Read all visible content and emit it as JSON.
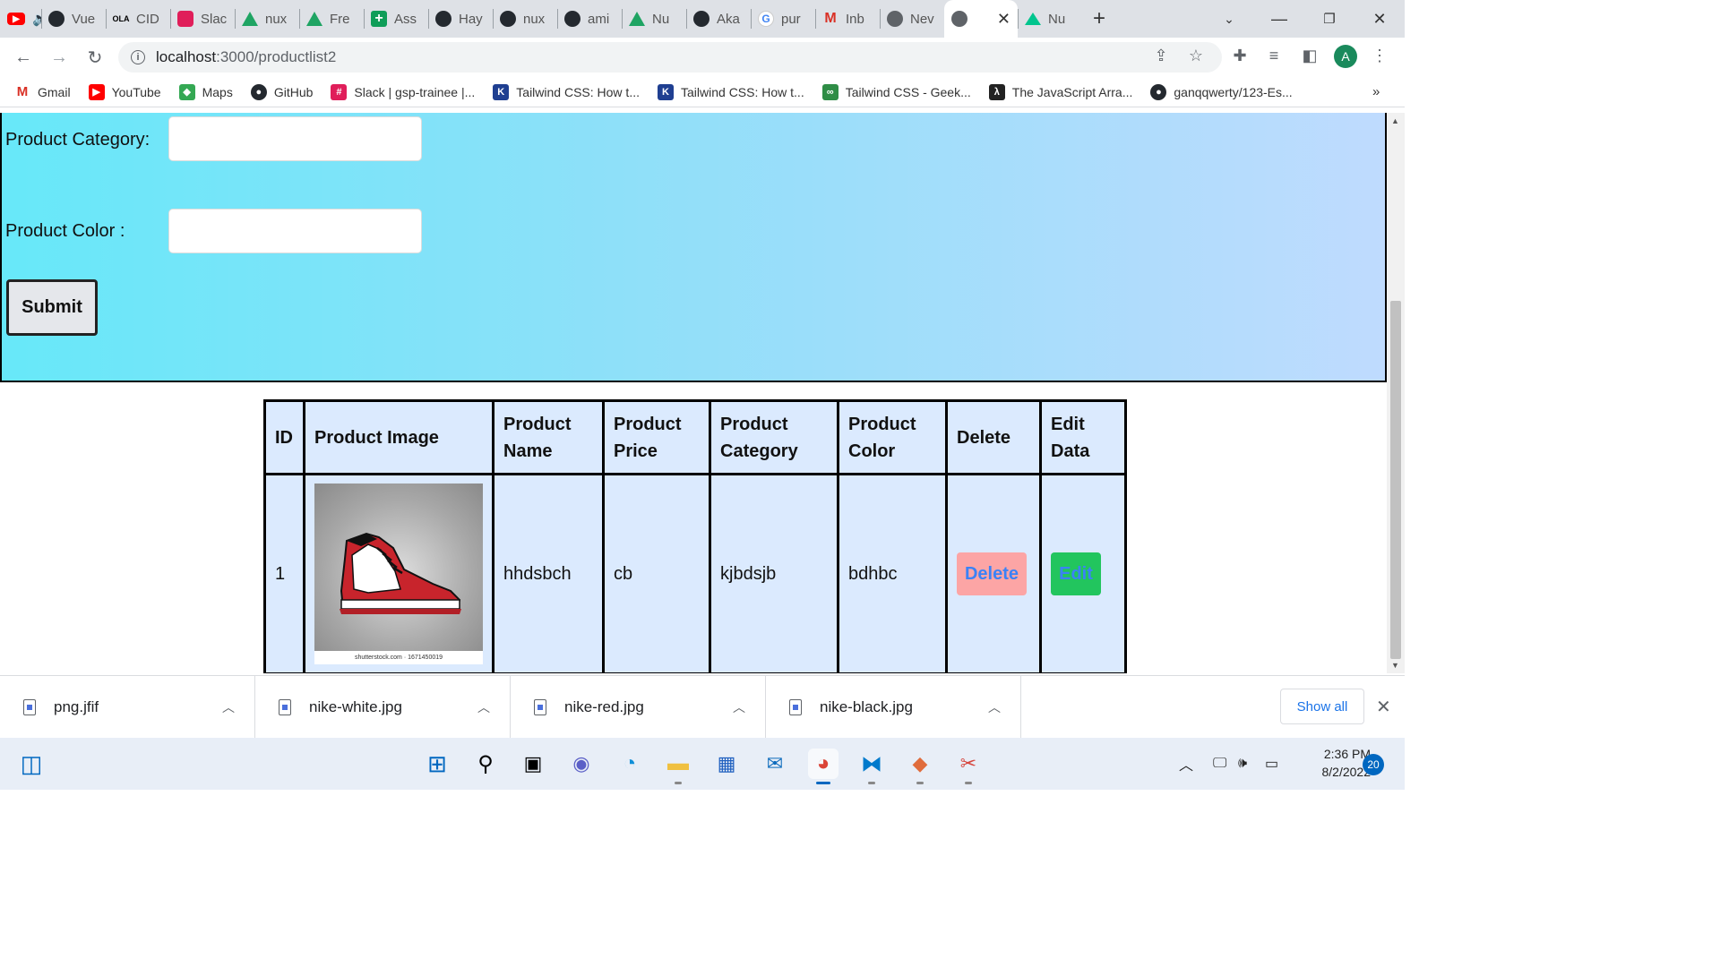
{
  "browser": {
    "tabs": [
      {
        "label": "",
        "icon": "youtube-icon"
      },
      {
        "label": "Vue",
        "icon": "github-icon"
      },
      {
        "label": "CID",
        "icon": "ola-icon"
      },
      {
        "label": "Slac",
        "icon": "slack-icon"
      },
      {
        "label": "nux",
        "icon": "drive-icon"
      },
      {
        "label": "Fre",
        "icon": "drive-icon"
      },
      {
        "label": "Ass",
        "icon": "plus-icon"
      },
      {
        "label": "Hay",
        "icon": "github-icon"
      },
      {
        "label": "nux",
        "icon": "github-icon"
      },
      {
        "label": "ami",
        "icon": "github-icon"
      },
      {
        "label": "Nu",
        "icon": "drive-icon"
      },
      {
        "label": "Aka",
        "icon": "github-icon"
      },
      {
        "label": "pur",
        "icon": "google-icon"
      },
      {
        "label": "Inb",
        "icon": "gmail-icon"
      },
      {
        "label": "Nev",
        "icon": "chrome-icon"
      },
      {
        "label": "",
        "icon": "globe-icon",
        "active": true
      },
      {
        "label": "Nu",
        "icon": "nuxt-icon"
      }
    ],
    "address": {
      "host": "localhost",
      "path": ":3000/productlist2"
    },
    "bookmarks": [
      {
        "label": "Gmail",
        "icon": "gmail-icon",
        "color": "#d93025"
      },
      {
        "label": "YouTube",
        "icon": "youtube-icon",
        "color": "#ff0000"
      },
      {
        "label": "Maps",
        "icon": "maps-icon",
        "color": "#34a853"
      },
      {
        "label": "GitHub",
        "icon": "github-icon",
        "color": "#24292f"
      },
      {
        "label": "Slack | gsp-trainee |...",
        "icon": "slack-icon",
        "color": "#e01e5a"
      },
      {
        "label": "Tailwind CSS: How t...",
        "icon": "k-icon",
        "color": "#1f3f91"
      },
      {
        "label": "Tailwind CSS: How t...",
        "icon": "k-icon",
        "color": "#1f3f91"
      },
      {
        "label": "Tailwind CSS - Geek...",
        "icon": "gfg-icon",
        "color": "#2f8d46"
      },
      {
        "label": "The JavaScript Arra...",
        "icon": "js-icon",
        "color": "#222222"
      },
      {
        "label": "ganqqwerty/123-Es...",
        "icon": "github-icon",
        "color": "#24292f"
      }
    ],
    "avatar_letter": "A"
  },
  "form": {
    "category_label": "Product Category:",
    "category_value": "",
    "color_label": "Product Color :",
    "color_value": "",
    "submit_label": "Submit"
  },
  "table": {
    "headers": [
      "ID",
      "Product Image",
      "Product Name",
      "Product Price",
      "Product Category",
      "Product Color",
      "Delete",
      "Edit Data"
    ],
    "rows": [
      {
        "id": "1",
        "image_caption": "shutterstock.com · 1671450019",
        "name": "hhdsbch",
        "price": "cb",
        "category": "kjbdsjb",
        "color": "bdhbc",
        "delete_label": "Delete",
        "edit_label": "Edit"
      }
    ]
  },
  "downloads": {
    "items": [
      "png.jfif",
      "nike-white.jpg",
      "nike-red.jpg",
      "nike-black.jpg"
    ],
    "show_all_label": "Show all"
  },
  "taskbar": {
    "time": "2:36 PM",
    "date": "8/2/2022",
    "notifications": "20"
  },
  "colors": {
    "form_gradient_start": "#67e8f9",
    "form_gradient_end": "#bfdbfe",
    "table_bg": "#dbeafe",
    "delete_bg": "#fca5a5",
    "edit_bg": "#22c55e",
    "button_text": "#3b82f6"
  }
}
